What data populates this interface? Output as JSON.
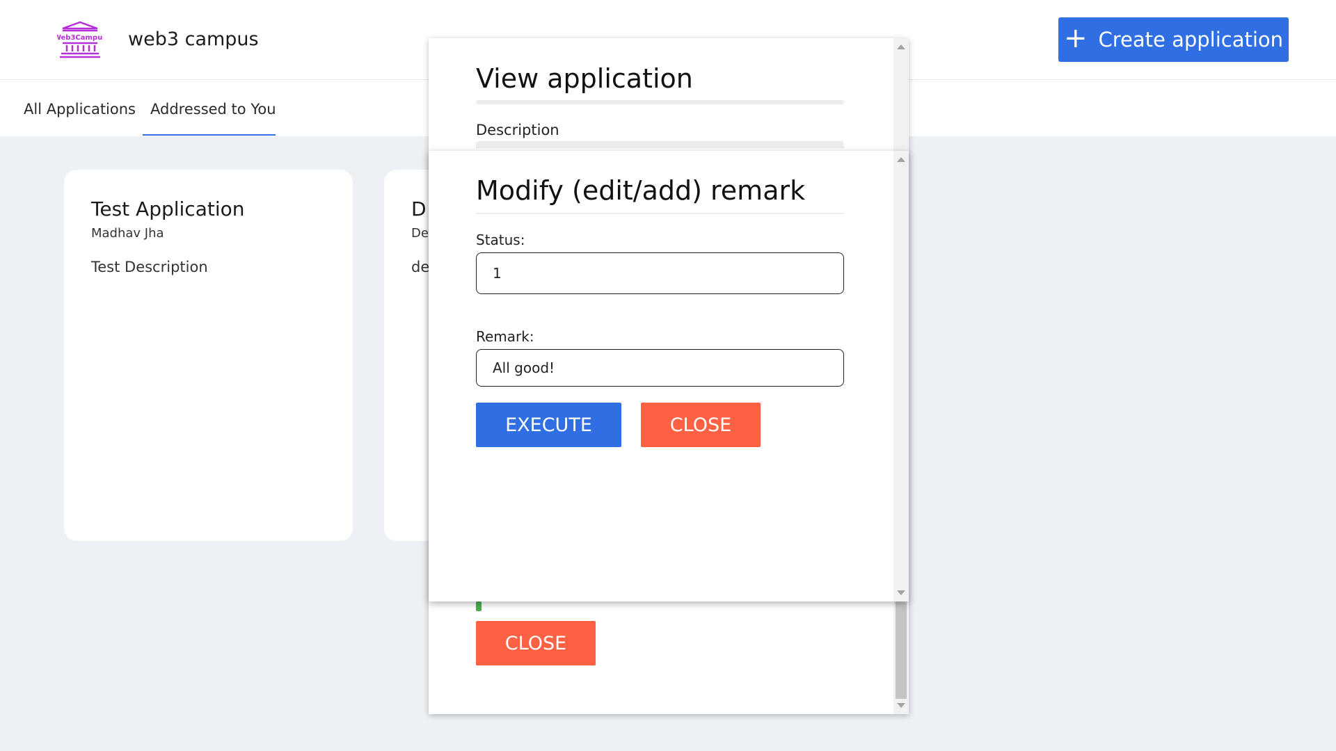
{
  "header": {
    "logo_text": "Web3Campus",
    "brand": "web3 campus",
    "create_button_label": "Create application"
  },
  "tabs": [
    {
      "label": "All Applications",
      "active": false
    },
    {
      "label": "Addressed to You",
      "active": true
    }
  ],
  "cards": [
    {
      "title": "Test Application",
      "author": "Madhav Jha",
      "description": "Test Description"
    },
    {
      "title": "D",
      "author": "De",
      "description": "de"
    }
  ],
  "view_modal": {
    "title": "View application",
    "description_label": "Description",
    "close_label": "CLOSE"
  },
  "remark_modal": {
    "title": "Modify (edit/add) remark",
    "status_label": "Status:",
    "status_value": "1",
    "remark_label": "Remark:",
    "remark_value": "All good!",
    "execute_label": "EXECUTE",
    "close_label": "CLOSE"
  },
  "colors": {
    "primary": "#2f6ee3",
    "danger": "#fb6142",
    "background": "#edf0f4",
    "logo": "#b52fd9"
  }
}
